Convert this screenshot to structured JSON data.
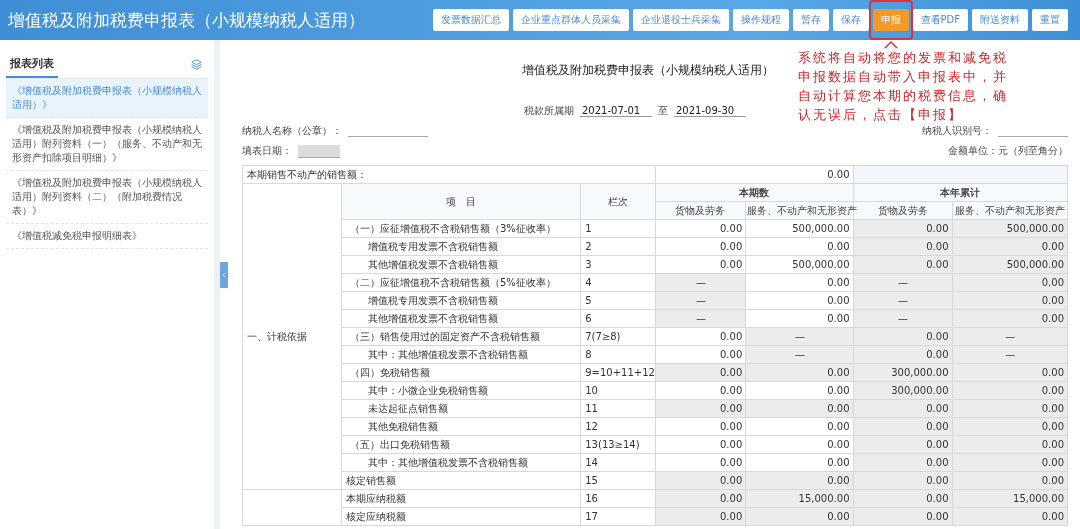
{
  "header": {
    "title": "增值税及附加税费申报表（小规模纳税人适用）",
    "buttons": [
      {
        "label": "发票数据汇总",
        "primary": false
      },
      {
        "label": "企业重点群体人员采集",
        "primary": false
      },
      {
        "label": "企业退役士兵采集",
        "primary": false
      },
      {
        "label": "操作规程",
        "primary": false
      },
      {
        "label": "暂存",
        "primary": false
      },
      {
        "label": "保存",
        "primary": false
      },
      {
        "label": "申报",
        "primary": true
      },
      {
        "label": "查看PDF",
        "primary": false
      },
      {
        "label": "附送资料",
        "primary": false
      },
      {
        "label": "重置",
        "primary": false
      }
    ]
  },
  "annotation": "系统将自动将您的发票和减免税申报数据自动带入申报表中，并自动计算您本期的税费信息，确认无误后，点击【申报】",
  "sidebar": {
    "tab": {
      "label": "报表列表",
      "selected": true
    },
    "items": [
      {
        "label": "《增值税及附加税费申报表（小规模纳税人适用）》",
        "selected": true
      },
      {
        "label": "《增值税及附加税费申报表（小规模纳税人适用）附列资料（一）（服务、不动产和无形资产扣除项目明细）》",
        "selected": false
      },
      {
        "label": "《增值税及附加税费申报表（小规模纳税人适用）附列资料（二）（附加税费情况表）》",
        "selected": false
      },
      {
        "label": "《增值税减免税申报明细表》",
        "selected": false
      }
    ]
  },
  "form": {
    "title": "增值税及附加税费申报表（小规模纳税人适用）",
    "period_label": "税款所属期",
    "period_from": "2021-07-01",
    "period_to_label": "至",
    "period_to": "2021-09-30",
    "taxpayer_name_label": "纳税人名称（公章）：",
    "taxpayer_id_label": "纳税人识别号：",
    "fill_date_label": "填表日期：",
    "unit": "金额单位：元（列至角分）"
  },
  "table": {
    "top_row": {
      "label": "本期销售不动产的销售额：",
      "value": "0.00"
    },
    "header": {
      "item": "项　目",
      "column_no": "栏次",
      "groups": [
        {
          "label": "本期数",
          "columns": [
            "货物及劳务",
            "服务、不动产和无形资产"
          ]
        },
        {
          "label": "本年累计",
          "columns": [
            "货物及劳务",
            "服务、不动产和无形资产"
          ]
        }
      ]
    },
    "sections": [
      {
        "label": "一、计税依据",
        "rows": [
          {
            "kind": "group",
            "item": "（一）应征增值税不含税销售额（3%征收率）",
            "no": "1",
            "cells": [
              {
                "value": "0.00",
                "locked": false
              },
              {
                "value": "500,000.00",
                "locked": false
              },
              {
                "value": "0.00",
                "locked": true
              },
              {
                "value": "500,000.00",
                "locked": true
              }
            ]
          },
          {
            "kind": "sub",
            "item": "增值税专用发票不含税销售额",
            "no": "2",
            "cells": [
              {
                "value": "0.00",
                "locked": false
              },
              {
                "value": "0.00",
                "locked": false
              },
              {
                "value": "0.00",
                "locked": true
              },
              {
                "value": "0.00",
                "locked": true
              }
            ]
          },
          {
            "kind": "sub",
            "item": "其他增值税发票不含税销售额",
            "no": "3",
            "cells": [
              {
                "value": "0.00",
                "locked": false
              },
              {
                "value": "500,000.00",
                "locked": false
              },
              {
                "value": "0.00",
                "locked": true
              },
              {
                "value": "500,000.00",
                "locked": true
              }
            ]
          },
          {
            "kind": "group",
            "item": "（二）应征增值税不含税销售额（5%征收率）",
            "no": "4",
            "cells": [
              {
                "value": "—",
                "locked": true
              },
              {
                "value": "0.00",
                "locked": false
              },
              {
                "value": "—",
                "locked": true
              },
              {
                "value": "0.00",
                "locked": true
              }
            ]
          },
          {
            "kind": "sub",
            "item": "增值税专用发票不含税销售额",
            "no": "5",
            "cells": [
              {
                "value": "—",
                "locked": true
              },
              {
                "value": "0.00",
                "locked": false
              },
              {
                "value": "—",
                "locked": true
              },
              {
                "value": "0.00",
                "locked": true
              }
            ]
          },
          {
            "kind": "sub",
            "item": "其他增值税发票不含税销售额",
            "no": "6",
            "cells": [
              {
                "value": "—",
                "locked": true
              },
              {
                "value": "0.00",
                "locked": false
              },
              {
                "value": "—",
                "locked": true
              },
              {
                "value": "0.00",
                "locked": true
              }
            ]
          },
          {
            "kind": "group",
            "item": "（三）销售使用过的固定资产不含税销售额",
            "no": "7(7≥8)",
            "cells": [
              {
                "value": "0.00",
                "locked": false
              },
              {
                "value": "—",
                "locked": true
              },
              {
                "value": "0.00",
                "locked": true
              },
              {
                "value": "—",
                "locked": true
              }
            ]
          },
          {
            "kind": "sub",
            "item": "其中：其他增值税发票不含税销售额",
            "no": "8",
            "cells": [
              {
                "value": "0.00",
                "locked": false
              },
              {
                "value": "—",
                "locked": true
              },
              {
                "value": "0.00",
                "locked": true
              },
              {
                "value": "—",
                "locked": true
              }
            ]
          },
          {
            "kind": "group",
            "item": "（四）免税销售额",
            "no": "9=10+11+12",
            "cells": [
              {
                "value": "0.00",
                "locked": true
              },
              {
                "value": "0.00",
                "locked": true
              },
              {
                "value": "300,000.00",
                "locked": true
              },
              {
                "value": "0.00",
                "locked": true
              }
            ]
          },
          {
            "kind": "sub",
            "item": "其中：小微企业免税销售额",
            "no": "10",
            "cells": [
              {
                "value": "0.00",
                "locked": false
              },
              {
                "value": "0.00",
                "locked": false
              },
              {
                "value": "300,000.00",
                "locked": true
              },
              {
                "value": "0.00",
                "locked": true
              }
            ]
          },
          {
            "kind": "sub",
            "item": "未达起征点销售额",
            "no": "11",
            "cells": [
              {
                "value": "0.00",
                "locked": true
              },
              {
                "value": "0.00",
                "locked": true
              },
              {
                "value": "0.00",
                "locked": true
              },
              {
                "value": "0.00",
                "locked": true
              }
            ]
          },
          {
            "kind": "sub",
            "item": "其他免税销售额",
            "no": "12",
            "cells": [
              {
                "value": "0.00",
                "locked": false
              },
              {
                "value": "0.00",
                "locked": false
              },
              {
                "value": "0.00",
                "locked": true
              },
              {
                "value": "0.00",
                "locked": true
              }
            ]
          },
          {
            "kind": "group",
            "item": "（五）出口免税销售额",
            "no": "13(13≥14)",
            "cells": [
              {
                "value": "0.00",
                "locked": false
              },
              {
                "value": "0.00",
                "locked": false
              },
              {
                "value": "0.00",
                "locked": true
              },
              {
                "value": "0.00",
                "locked": true
              }
            ]
          },
          {
            "kind": "sub",
            "item": "其中：其他增值税发票不含税销售额",
            "no": "14",
            "cells": [
              {
                "value": "0.00",
                "locked": false
              },
              {
                "value": "0.00",
                "locked": false
              },
              {
                "value": "0.00",
                "locked": true
              },
              {
                "value": "0.00",
                "locked": true
              }
            ]
          },
          {
            "kind": "plain",
            "item": "核定销售额",
            "no": "15",
            "cells": [
              {
                "value": "0.00",
                "locked": true
              },
              {
                "value": "0.00",
                "locked": true
              },
              {
                "value": "0.00",
                "locked": true
              },
              {
                "value": "0.00",
                "locked": true
              }
            ]
          }
        ]
      },
      {
        "rows": [
          {
            "kind": "plain",
            "item": "本期应纳税额",
            "no": "16",
            "cells": [
              {
                "value": "0.00",
                "locked": true
              },
              {
                "value": "15,000.00",
                "locked": true
              },
              {
                "value": "0.00",
                "locked": true
              },
              {
                "value": "15,000.00",
                "locked": true
              }
            ]
          },
          {
            "kind": "plain",
            "item": "核定应纳税额",
            "no": "17",
            "cells": [
              {
                "value": "0.00",
                "locked": true
              },
              {
                "value": "0.00",
                "locked": true
              },
              {
                "value": "0.00",
                "locked": true
              },
              {
                "value": "0.00",
                "locked": true
              }
            ]
          }
        ]
      }
    ]
  }
}
